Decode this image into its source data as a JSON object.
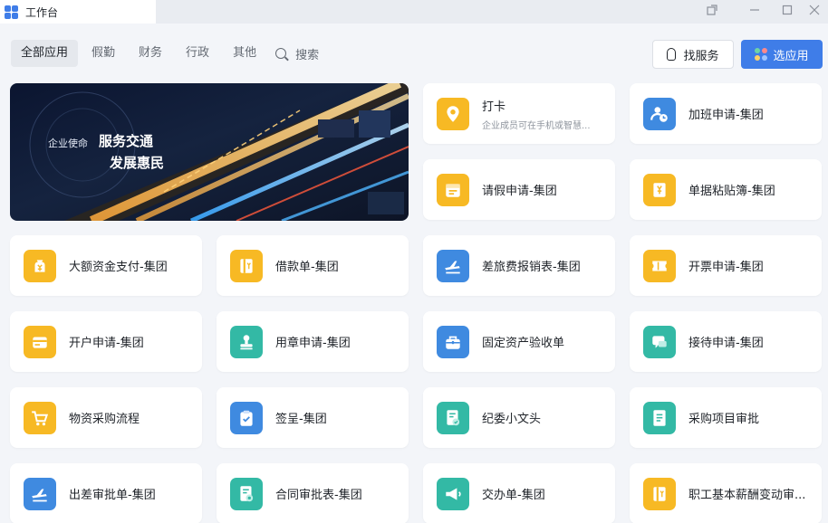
{
  "window": {
    "title": "工作台"
  },
  "filters": {
    "items": [
      "全部应用",
      "假勤",
      "财务",
      "行政",
      "其他"
    ],
    "search_label": "搜索"
  },
  "actions": {
    "find_service": "找服务",
    "pick_app": "选应用"
  },
  "banner": {
    "tag": "企业使命",
    "line1": "服务交通",
    "line2": "发展惠民"
  },
  "apps": [
    {
      "name": "打卡",
      "sub": "企业成员可在手机或智慧...",
      "color": "yellow",
      "icon": "location-pin-icon"
    },
    {
      "name": "加班申请-集团",
      "color": "blue",
      "icon": "overtime-clock-icon"
    },
    {
      "name": "请假申请-集团",
      "color": "yellow",
      "icon": "calendar-icon"
    },
    {
      "name": "单据粘贴簿-集团",
      "color": "yellow",
      "icon": "receipt-icon"
    },
    {
      "name": "大额资金支付-集团",
      "color": "yellow",
      "icon": "money-bag-icon"
    },
    {
      "name": "借款单-集团",
      "color": "yellow",
      "icon": "loan-icon"
    },
    {
      "name": "差旅费报销表-集团",
      "color": "blue",
      "icon": "airplane-icon"
    },
    {
      "name": "开票申请-集团",
      "color": "yellow",
      "icon": "ticket-icon"
    },
    {
      "name": "开户申请-集团",
      "color": "yellow",
      "icon": "card-icon"
    },
    {
      "name": "用章申请-集团",
      "color": "teal",
      "icon": "stamp-icon"
    },
    {
      "name": "固定资产验收单",
      "color": "blue",
      "icon": "toolbox-icon"
    },
    {
      "name": "接待申请-集团",
      "color": "teal",
      "icon": "chat-icon"
    },
    {
      "name": "物资采购流程",
      "color": "yellow",
      "icon": "cart-icon"
    },
    {
      "name": "签呈-集团",
      "color": "blue",
      "icon": "clipboard-icon"
    },
    {
      "name": "纪委小文头",
      "color": "teal",
      "icon": "document-check-icon"
    },
    {
      "name": "采购项目审批",
      "color": "teal",
      "icon": "document-list-icon"
    },
    {
      "name": "出差审批单-集团",
      "color": "blue",
      "icon": "airplane-icon"
    },
    {
      "name": "合同审批表-集团",
      "color": "teal",
      "icon": "contract-icon"
    },
    {
      "name": "交办单-集团",
      "color": "teal",
      "icon": "megaphone-icon"
    },
    {
      "name": "职工基本薪酬变动审...",
      "color": "yellow",
      "icon": "salary-icon"
    }
  ]
}
